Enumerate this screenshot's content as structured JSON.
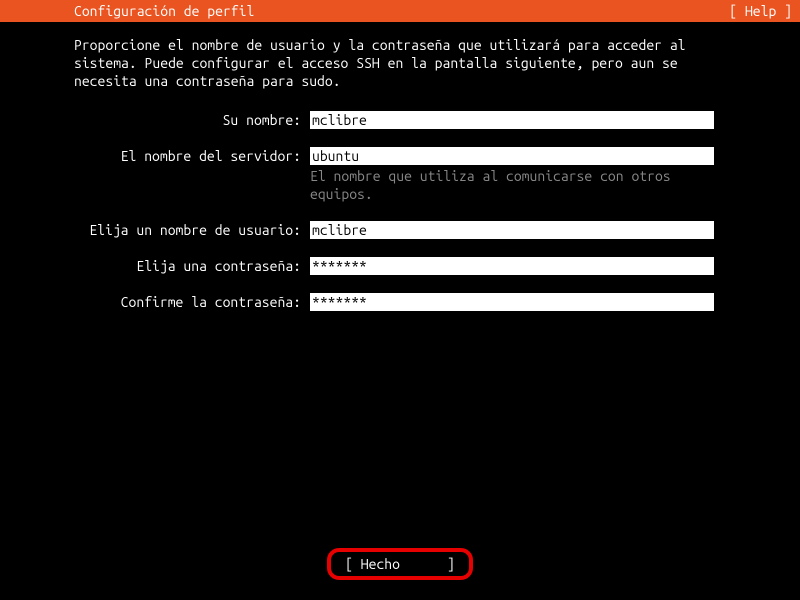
{
  "header": {
    "title": "Configuración de perfil",
    "help": "[ Help ]"
  },
  "description": "Proporcione el nombre de usuario y la contraseña que utilizará para acceder al sistema. Puede configurar el acceso SSH en la pantalla siguiente, pero aun se necesita una contraseña para sudo.",
  "form": {
    "name_label": "Su nombre:",
    "name_value": "mclibre",
    "server_label": "El nombre del servidor:",
    "server_value": "ubuntu",
    "server_hint": "El nombre que utiliza al comunicarse con otros equipos.",
    "username_label": "Elija un nombre de usuario:",
    "username_value": "mclibre",
    "password_label": "Elija una contraseña:",
    "password_value": "*******",
    "confirm_label": "Confirme la contraseña:",
    "confirm_value": "*******"
  },
  "footer": {
    "done": "[ Hecho      ]"
  }
}
